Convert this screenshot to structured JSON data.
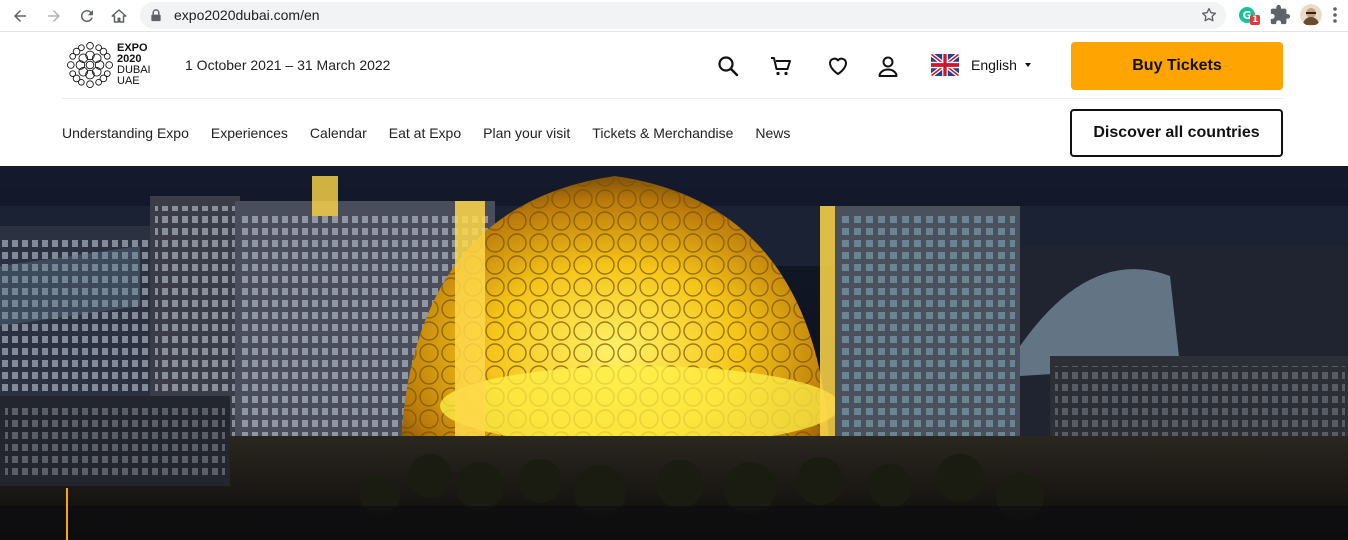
{
  "browser": {
    "url": "expo2020dubai.com/en",
    "extension_badge": "1"
  },
  "header": {
    "logo_lines": [
      "EXPO",
      "2020",
      "DUBAI",
      "UAE"
    ],
    "dates": "1 October 2021 – 31 March 2022",
    "language": "English",
    "buy_tickets": "Buy Tickets",
    "discover_countries": "Discover all countries"
  },
  "menu": [
    {
      "label": "Understanding Expo"
    },
    {
      "label": "Experiences"
    },
    {
      "label": "Calendar"
    },
    {
      "label": "Eat at Expo"
    },
    {
      "label": "Plan your visit"
    },
    {
      "label": "Tickets & Merchandise"
    },
    {
      "label": "News"
    }
  ],
  "icons": {
    "back": "arrow-left-icon",
    "forward": "arrow-right-icon",
    "reload": "reload-icon",
    "home": "home-icon",
    "lock": "lock-icon",
    "bookmark": "star-icon",
    "search": "search-icon",
    "cart": "cart-icon",
    "wishlist": "heart-icon",
    "account": "user-icon",
    "flag": "uk-flag-icon"
  },
  "colors": {
    "accent": "#ffa400",
    "text": "#111111"
  }
}
